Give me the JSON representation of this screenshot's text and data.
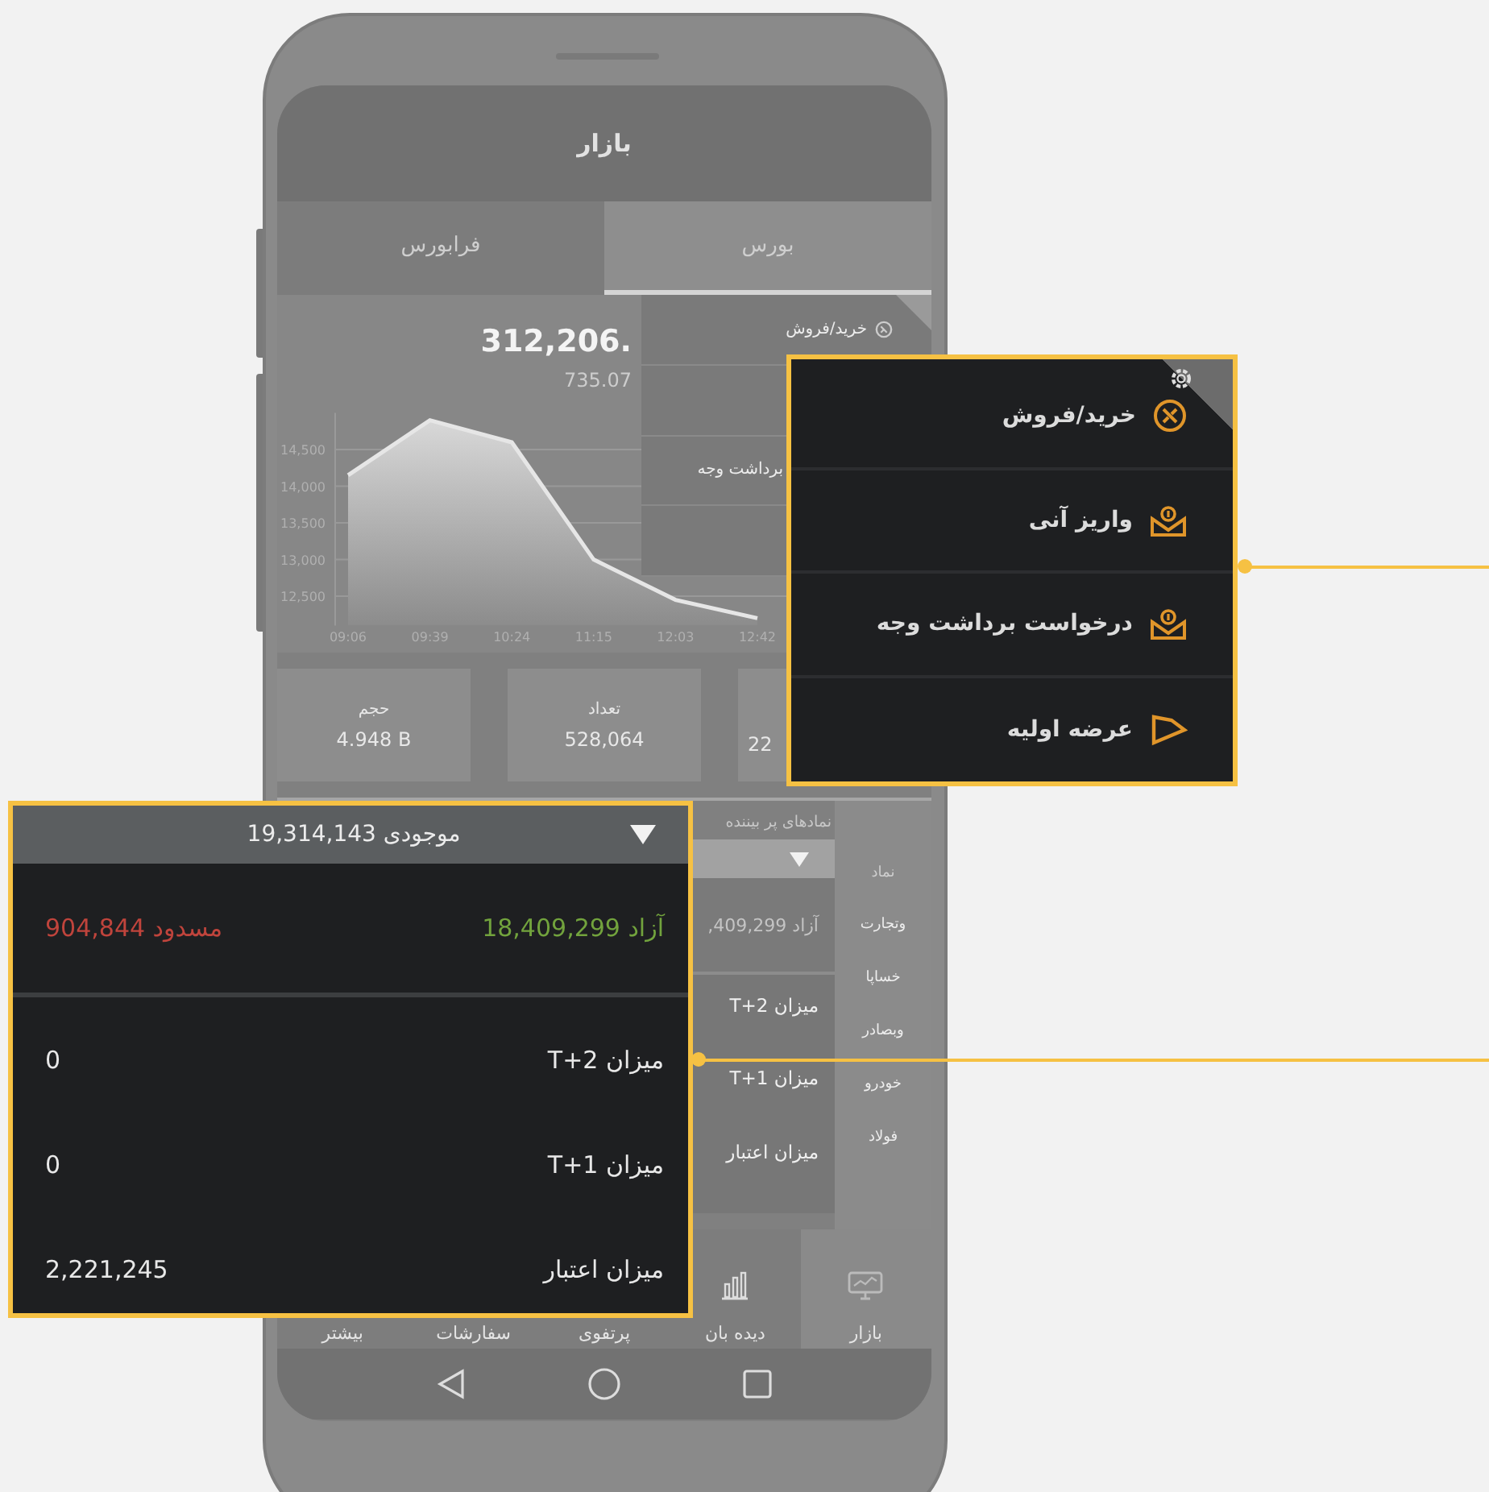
{
  "header": {
    "title": "بازار"
  },
  "tabs": [
    {
      "label": "بورس",
      "selected": true
    },
    {
      "label": "فرابورس",
      "selected": false
    }
  ],
  "index": {
    "value": "312,206.",
    "change": "735.07",
    "chart_data": {
      "type": "area",
      "grid": true,
      "ylim": [
        12100,
        15000
      ],
      "x": [
        "09:06",
        "09:39",
        "10:24",
        "11:15",
        "12:03",
        "12:42"
      ],
      "values": [
        14150,
        14900,
        14600,
        13000,
        12450,
        12200
      ],
      "yticks": [
        {
          "value": 12500,
          "label": "12,500"
        },
        {
          "value": 13000,
          "label": "13,000"
        },
        {
          "value": 13500,
          "label": "13,500"
        },
        {
          "value": 14000,
          "label": "14,000"
        },
        {
          "value": 14500,
          "label": "14,500"
        }
      ]
    }
  },
  "side_menu": {
    "items": [
      {
        "label": "خرید/فروش"
      },
      {
        "label": "برداشت وجه"
      }
    ]
  },
  "stats": [
    {
      "value": "22"
    },
    {
      "label": "تعداد",
      "value": "528,064"
    },
    {
      "label": "حجم",
      "value": "4.948 B"
    }
  ],
  "most_viewed": {
    "title": "نمادهای پر بیننده",
    "free": "آزاد 409,299,",
    "rows": [
      "میزان T+2",
      "میزان T+1",
      "میزان اعتبار"
    ]
  },
  "symbols": {
    "header": "نماد",
    "items": [
      "وتجارت",
      "خساپا",
      "وبصادر",
      "خودرو",
      "فولاد"
    ]
  },
  "bottom_nav": [
    {
      "label": "بازار",
      "selected": true
    },
    {
      "label": "دیده بان",
      "selected": false
    },
    {
      "label": "پرتفوی",
      "selected": false
    },
    {
      "label": "سفارشات",
      "selected": false
    },
    {
      "label": "بیشتر",
      "selected": false
    }
  ],
  "menu_callout": {
    "items": [
      {
        "label": "خرید/فروش"
      },
      {
        "label": "واریز آنی"
      },
      {
        "label": "درخواست برداشت وجه"
      },
      {
        "label": "عرضه اولیه"
      }
    ]
  },
  "balance_callout": {
    "header": "موجودی 19,314,143",
    "free": {
      "text": "آزاد 18,409,299",
      "color": "#72a33d"
    },
    "blocked": {
      "text": "مسدود 904,844",
      "color": "#c0443c"
    },
    "rows": [
      {
        "label": "میزان T+2",
        "value": "0"
      },
      {
        "label": "میزان T+1",
        "value": "0"
      },
      {
        "label": "میزان اعتبار",
        "value": "2,221,245"
      }
    ]
  }
}
